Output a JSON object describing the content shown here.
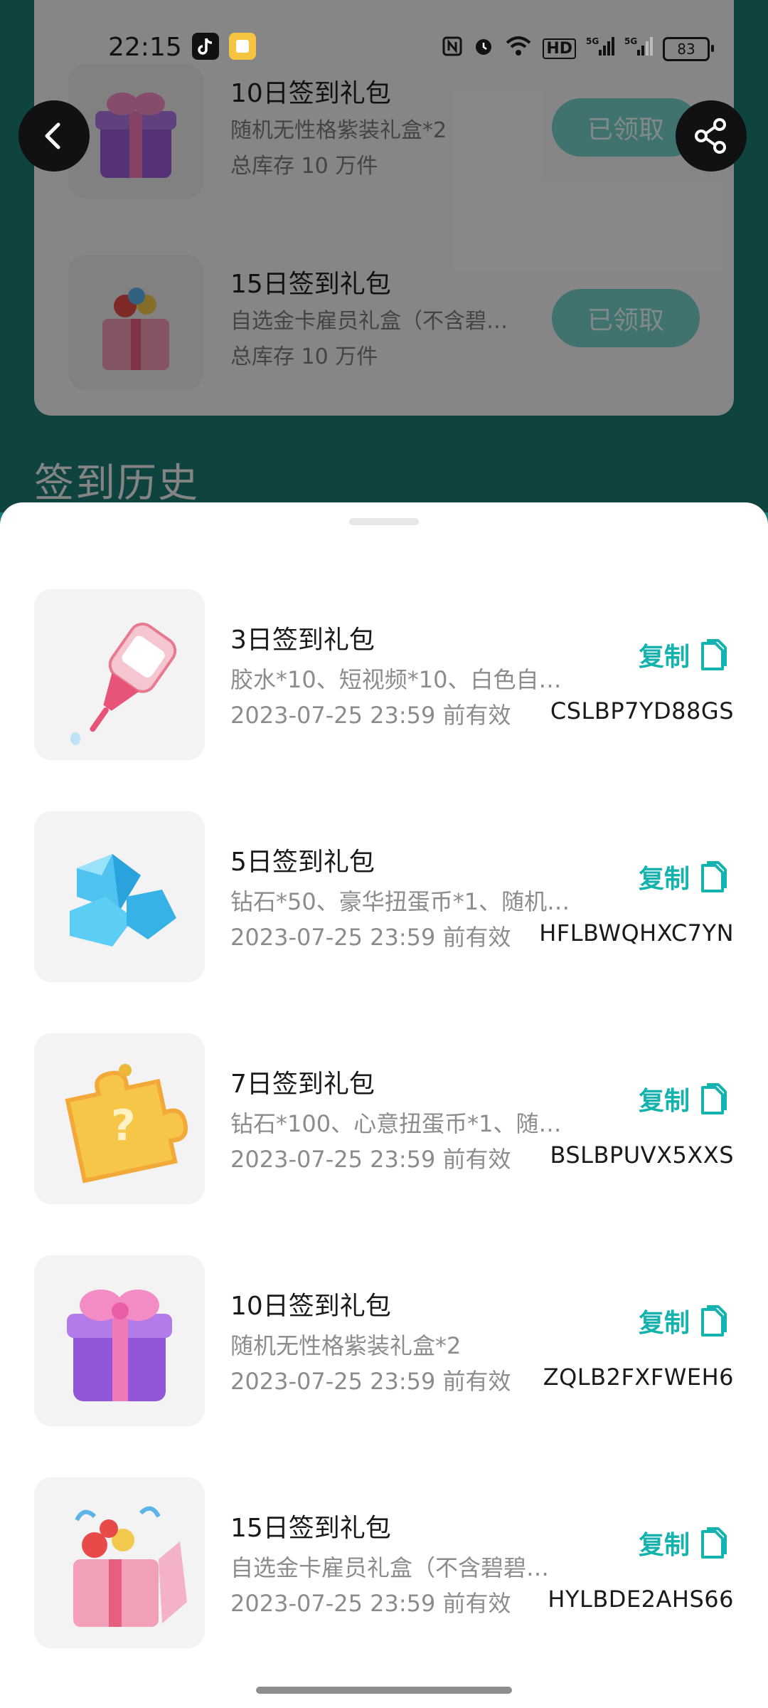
{
  "status_bar": {
    "time": "22:15",
    "battery": "83",
    "network_label": "HD",
    "signal_1": "5G",
    "signal_2": "5G"
  },
  "background": {
    "rewards": [
      {
        "title": "10日签到礼包",
        "desc": "随机无性格紫装礼盒*2",
        "stock": "总库存 10 万件",
        "button": "已领取"
      },
      {
        "title": "15日签到礼包",
        "desc": "自选金卡雇员礼盒（不含碧…",
        "stock": "总库存 10 万件",
        "button": "已领取"
      }
    ],
    "section_title": "签到历史"
  },
  "sheet": {
    "copy_label": "复制",
    "items": [
      {
        "title": "3日签到礼包",
        "desc": "胶水*10、短视频*10、白色自…",
        "expiry": "2023-07-25 23:59 前有效",
        "code": "CSLBP7YD88GS",
        "image": "glue-bottle"
      },
      {
        "title": "5日签到礼包",
        "desc": "钻石*50、豪华扭蛋币*1、随机…",
        "expiry": "2023-07-25 23:59 前有效",
        "code": "HFLBWQHXC7YN",
        "image": "diamonds"
      },
      {
        "title": "7日签到礼包",
        "desc": "钻石*100、心意扭蛋币*1、随…",
        "expiry": "2023-07-25 23:59 前有效",
        "code": "BSLBPUVX5XXS",
        "image": "puzzle-piece"
      },
      {
        "title": "10日签到礼包",
        "desc": "随机无性格紫装礼盒*2",
        "expiry": "2023-07-25 23:59 前有效",
        "code": "ZQLB2FXFWEH6",
        "image": "purple-gift-box"
      },
      {
        "title": "15日签到礼包",
        "desc": "自选金卡雇员礼盒（不含碧碧…",
        "expiry": "2023-07-25 23:59 前有效",
        "code": "HYLBDE2AHS66",
        "image": "pink-gift-box"
      }
    ]
  },
  "colors": {
    "accent": "#15b3ad",
    "background_teal": "#1c7a76",
    "claimed_button": "#76d1ca"
  }
}
